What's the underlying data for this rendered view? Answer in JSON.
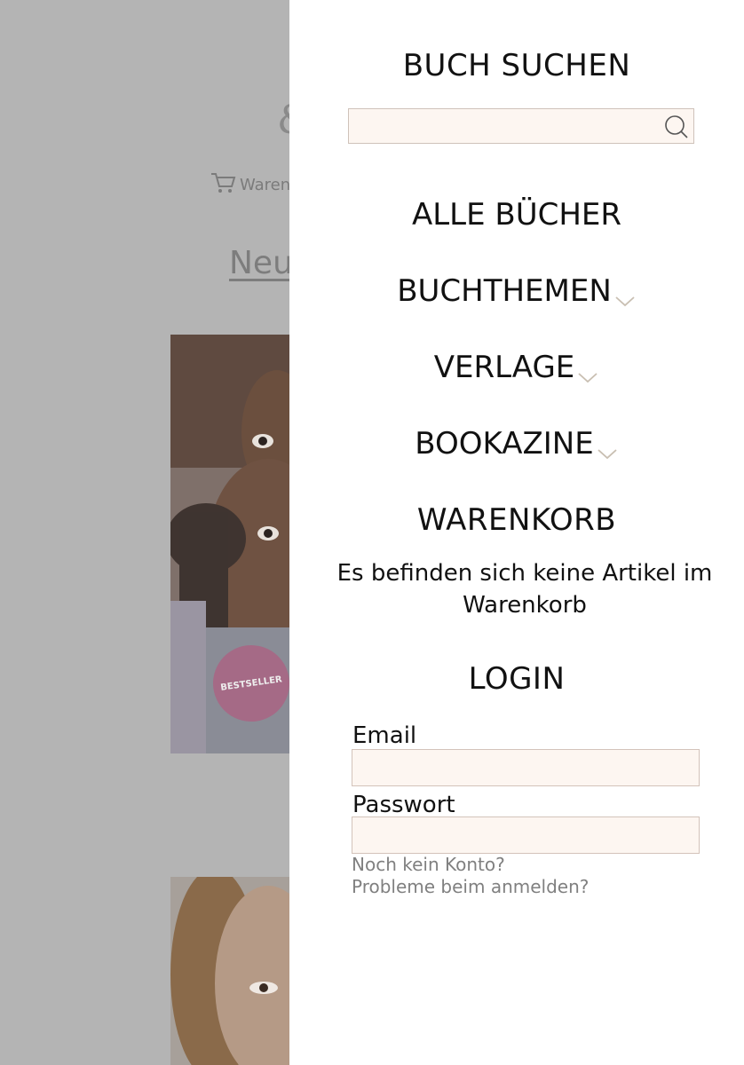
{
  "background": {
    "cart_label": "Warenk",
    "heading": "Neu",
    "badge_text": "BESTSELLER",
    "icons": [
      "shopping-cart-icon"
    ]
  },
  "drawer": {
    "search": {
      "title": "BUCH SUCHEN",
      "value": "",
      "placeholder": "",
      "icon": "search-icon"
    },
    "nav": {
      "all_books": "ALLE BÜCHER",
      "topics": "BUCHTHEMEN",
      "publishers": "VERLAGE",
      "bookazines": "BOOKAZINE",
      "chevron_icon": "chevron-down-icon"
    },
    "cart": {
      "title": "WARENKORB",
      "empty_message": "Es befinden sich keine Artikel im Warenkorb"
    },
    "login": {
      "title": "LOGIN",
      "email_label": "Email",
      "email_value": "",
      "password_label": "Passwort",
      "password_value": "",
      "no_account_link": "Noch kein Konto?",
      "problems_link": "Probleme beim anmelden?"
    }
  },
  "colors": {
    "overlay": "#b4b4b4",
    "input_bg": "#fdf6f1",
    "input_border": "#d3c3ba",
    "chevron": "#c9bfb2",
    "link": "#808080"
  }
}
